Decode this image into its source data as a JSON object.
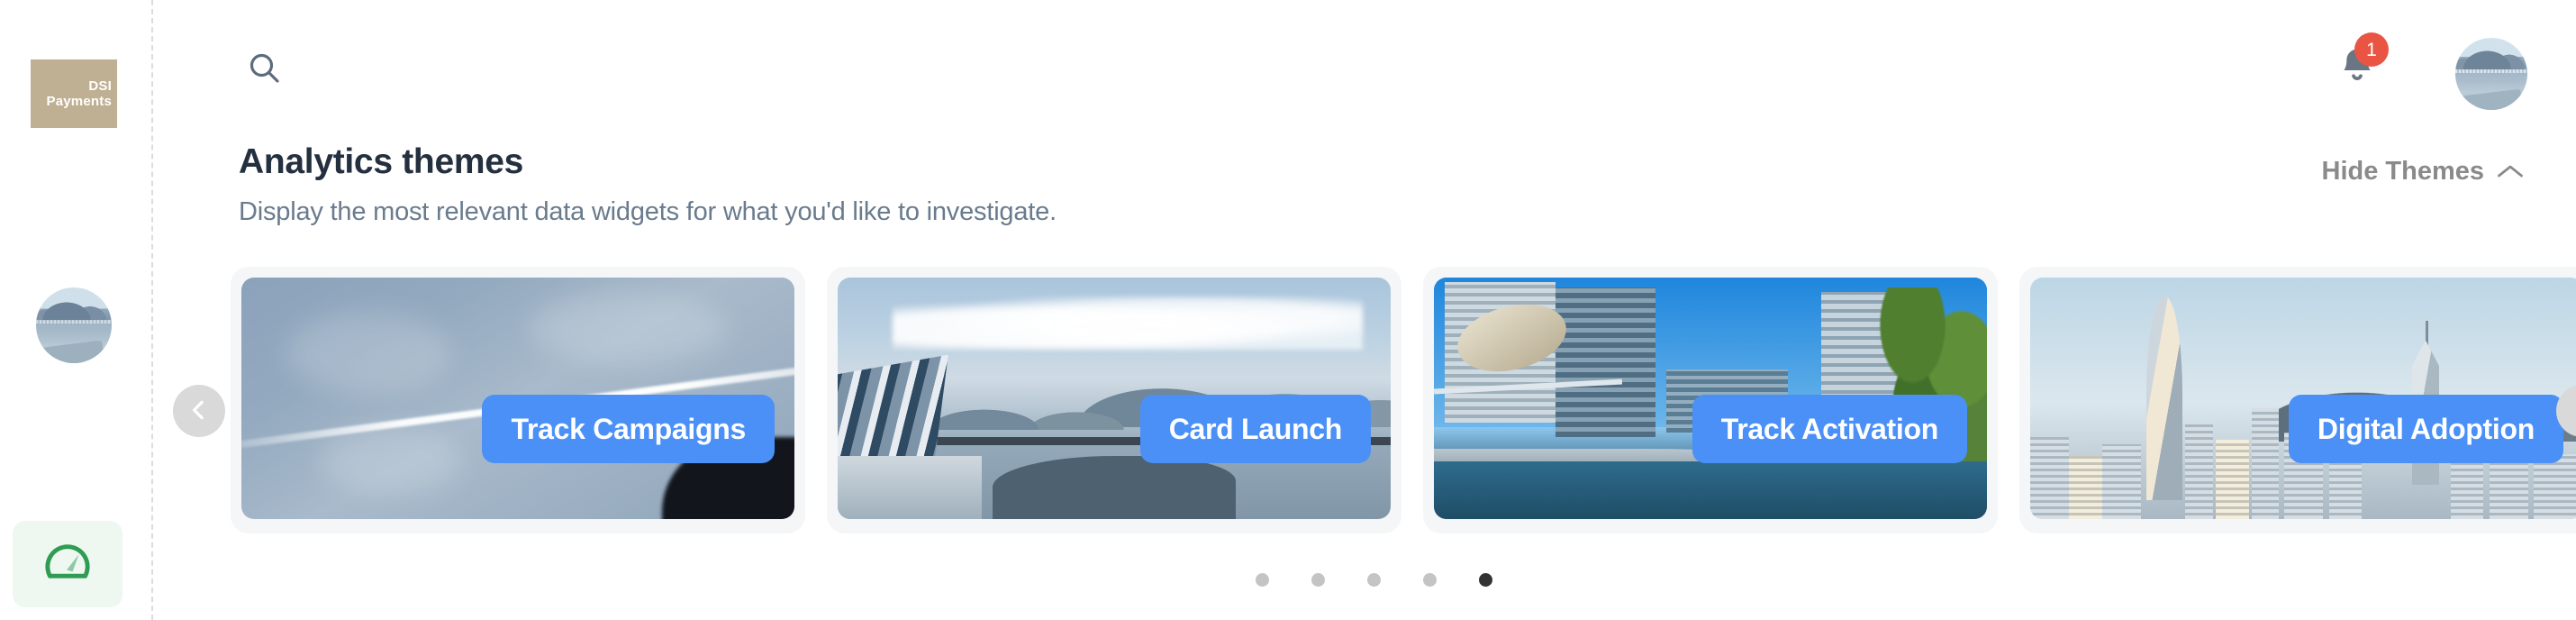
{
  "sidebar": {
    "brand": {
      "line1": "DSI",
      "line2": "Payments",
      "bg": "#bfb093"
    },
    "avatar_name": "user-avatar",
    "nav": [
      {
        "id": "dashboard",
        "icon": "speedometer-icon",
        "active": true,
        "accent": "#2e9c52"
      }
    ]
  },
  "topbar": {
    "search_icon": "search-icon",
    "notifications": {
      "icon": "bell-icon",
      "count": "1",
      "badge_color": "#ea5543"
    },
    "profile": {
      "icon": "avatar"
    }
  },
  "section": {
    "title": "Analytics themes",
    "subtitle": "Display the most relevant data widgets for what you'd like to investigate.",
    "toggle_label": "Hide Themes",
    "toggle_icon": "chevron-up-icon"
  },
  "carousel": {
    "prev_label": "chevron-left-icon",
    "next_label": "chevron-right-icon",
    "accent": "#4a90f7",
    "cards": [
      {
        "button_label": "Track Campaigns",
        "art": "sky-contrail"
      },
      {
        "button_label": "Card Launch",
        "art": "harbour-vista"
      },
      {
        "button_label": "Track Activation",
        "art": "science-park"
      },
      {
        "button_label": "Digital Adoption",
        "art": "city-skyline"
      }
    ],
    "pagination": {
      "total": 5,
      "active_index": 4
    }
  }
}
